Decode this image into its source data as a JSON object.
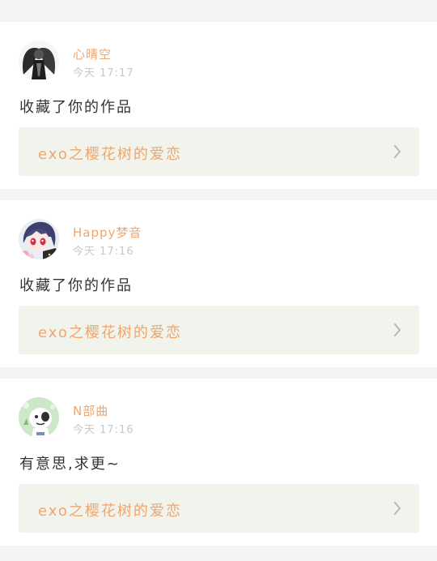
{
  "feed": {
    "items": [
      {
        "username": "心晴空",
        "time": "今天 17:17",
        "message": "收藏了你的作品",
        "work_title": "exo之樱花树的爱恋",
        "avatar_icon": "dark-angel-avatar"
      },
      {
        "username": "Happy梦音",
        "time": "今天 17:16",
        "message": "收藏了你的作品",
        "work_title": "exo之樱花树的爱恋",
        "avatar_icon": "anime-girl-avatar"
      },
      {
        "username": "N部曲",
        "time": "今天 17:16",
        "message": "有意思,求更~",
        "work_title": "exo之樱花树的爱恋",
        "avatar_icon": "green-cartoon-avatar"
      }
    ]
  },
  "colors": {
    "accent": "#f0a56c",
    "work_bg": "#f1f4ec",
    "time": "#c8c8c8"
  }
}
